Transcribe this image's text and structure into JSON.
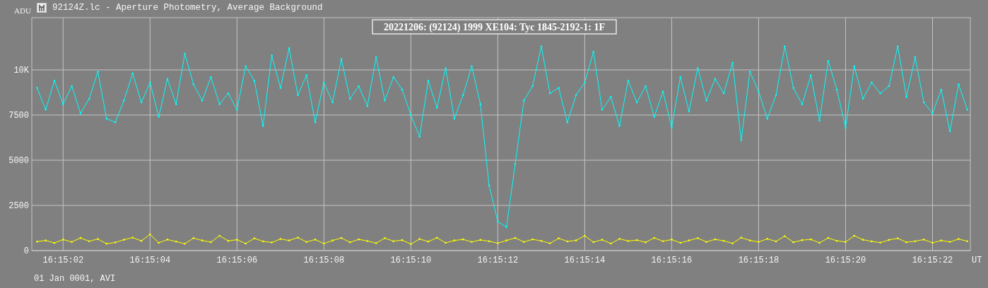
{
  "window": {
    "title": "92124Z.lc - Aperture Photometry, Average Background"
  },
  "plot": {
    "chart_data": {
      "type": "line",
      "title": "20221206: (92124) 1999 XE104: Tyc 1845-2192-1: 1F",
      "xlabel": "UT",
      "ylabel": "ADU",
      "x": [
        58501.4,
        58501.6,
        58501.8,
        58502.0,
        58502.2,
        58502.4,
        58502.6,
        58502.8,
        58503.0,
        58503.2,
        58503.4,
        58503.6,
        58503.8,
        58504.0,
        58504.2,
        58504.4,
        58504.6,
        58504.8,
        58505.0,
        58505.2,
        58505.4,
        58505.6,
        58505.8,
        58506.0,
        58506.2,
        58506.4,
        58506.6,
        58506.8,
        58507.0,
        58507.2,
        58507.4,
        58507.6,
        58507.8,
        58508.0,
        58508.2,
        58508.4,
        58508.6,
        58508.8,
        58509.0,
        58509.2,
        58509.4,
        58509.6,
        58509.8,
        58510.0,
        58510.2,
        58510.4,
        58510.6,
        58510.8,
        58511.0,
        58511.2,
        58511.4,
        58511.6,
        58511.8,
        58512.0,
        58512.2,
        58512.4,
        58512.6,
        58512.8,
        58513.0,
        58513.2,
        58513.4,
        58513.6,
        58513.8,
        58514.0,
        58514.2,
        58514.4,
        58514.6,
        58514.8,
        58515.0,
        58515.2,
        58515.4,
        58515.6,
        58515.8,
        58516.0,
        58516.2,
        58516.4,
        58516.6,
        58516.8,
        58517.0,
        58517.2,
        58517.4,
        58517.6,
        58517.8,
        58518.0,
        58518.2,
        58518.4,
        58518.6,
        58518.8,
        58519.0,
        58519.2,
        58519.4,
        58519.6,
        58519.8,
        58520.0,
        58520.2,
        58520.4,
        58520.6,
        58520.8,
        58521.0,
        58521.2,
        58521.4,
        58521.6,
        58521.8,
        58522.0,
        58522.2,
        58522.4,
        58522.6,
        58522.8
      ],
      "series": [
        {
          "color": "#00ffff",
          "values": [
            9000,
            7800,
            9400,
            8100,
            9100,
            7600,
            8400,
            9900,
            7300,
            7100,
            8300,
            9800,
            8200,
            9300,
            7400,
            9500,
            8100,
            10900,
            9200,
            8300,
            9600,
            8100,
            8700,
            7800,
            10200,
            9400,
            6900,
            10800,
            9000,
            11200,
            8600,
            9700,
            7100,
            9300,
            8200,
            10600,
            8400,
            9100,
            8000,
            10700,
            8300,
            9600,
            8900,
            7500,
            6300,
            9400,
            7900,
            10100,
            7300,
            8600,
            10200,
            8100,
            3600,
            1600,
            1300,
            4800,
            8300,
            9100,
            11300,
            8700,
            9000,
            7100,
            8600,
            9300,
            11000,
            7800,
            8500,
            6900,
            9400,
            8200,
            9100,
            7400,
            8800,
            6800,
            9600,
            7700,
            10100,
            8300,
            9500,
            8700,
            10400,
            6100,
            9900,
            8800,
            7300,
            8600,
            11300,
            9000,
            8100,
            9700,
            7200,
            10500,
            8900,
            6800,
            10200,
            8400,
            9300,
            8700,
            9100,
            11300,
            8500,
            10700,
            8200,
            7600,
            8900,
            6600,
            9200,
            7800
          ]
        },
        {
          "color": "#ffff00",
          "values": [
            500,
            560,
            420,
            610,
            480,
            700,
            520,
            640,
            380,
            450,
            600,
            720,
            540,
            900,
            430,
            610,
            500,
            380,
            690,
            560,
            470,
            820,
            540,
            600,
            390,
            680,
            510,
            450,
            640,
            560,
            720,
            480,
            610,
            390,
            560,
            700,
            460,
            620,
            530,
            410,
            690,
            520,
            580,
            360,
            640,
            500,
            710,
            430,
            560,
            620,
            480,
            590,
            520,
            410,
            560,
            700,
            480,
            620,
            540,
            400,
            680,
            510,
            560,
            820,
            470,
            600,
            390,
            650,
            530,
            580,
            460,
            700,
            520,
            610,
            430,
            560,
            690,
            480,
            620,
            540,
            400,
            720,
            560,
            480,
            650,
            510,
            800,
            460,
            580,
            620,
            430,
            700,
            540,
            480,
            820,
            600,
            510,
            440,
            590,
            680,
            460,
            520,
            610,
            430,
            560,
            480,
            640,
            520
          ]
        }
      ],
      "grid": true,
      "xlim": [
        58501.28,
        58522.87
      ],
      "ylim": [
        0,
        12890
      ],
      "xticks": [
        {
          "value": 58502,
          "label": "16:15:02"
        },
        {
          "value": 58504,
          "label": "16:15:04"
        },
        {
          "value": 58506,
          "label": "16:15:06"
        },
        {
          "value": 58508,
          "label": "16:15:08"
        },
        {
          "value": 58510,
          "label": "16:15:10"
        },
        {
          "value": 58512,
          "label": "16:15:12"
        },
        {
          "value": 58514,
          "label": "16:15:14"
        },
        {
          "value": 58516,
          "label": "16:15:16"
        },
        {
          "value": 58518,
          "label": "16:15:18"
        },
        {
          "value": 58520,
          "label": "16:15:20"
        },
        {
          "value": 58522,
          "label": "16:15:22"
        }
      ],
      "yticks": [
        0,
        2500,
        5000,
        7500,
        {
          "value": 10000,
          "label": "10K"
        }
      ]
    }
  },
  "footer": "01 Jan 0001, AVI"
}
